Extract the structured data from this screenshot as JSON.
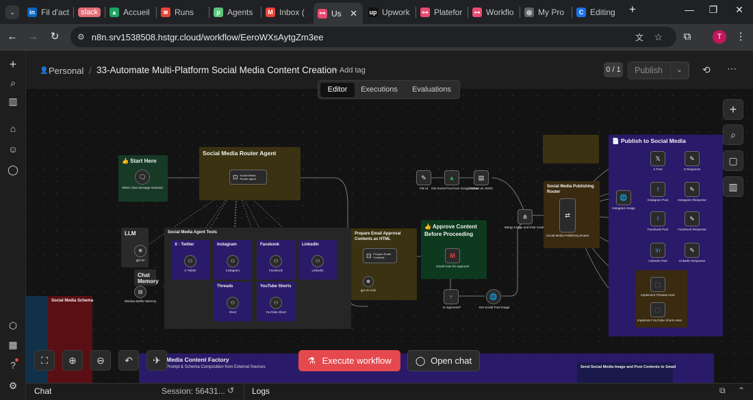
{
  "browser": {
    "tabs": [
      {
        "label": "Fil d'act",
        "icon": "linkedin-icon",
        "color": "#0a66c2",
        "glyph": "in"
      },
      {
        "label": "slack",
        "icon": "slack-badge-icon",
        "color": "#e06c75",
        "glyph": ""
      },
      {
        "label": "Accueil",
        "icon": "google-drive-icon",
        "color": "#1fa463",
        "glyph": "▲"
      },
      {
        "label": "Runs",
        "icon": "runs-icon",
        "color": "#e8453c",
        "glyph": "≋"
      },
      {
        "label": "Agents",
        "icon": "agents-icon",
        "color": "#5bc57a",
        "glyph": "p"
      },
      {
        "label": "Inbox (",
        "icon": "gmail-icon",
        "color": "#ea4335",
        "glyph": "M"
      },
      {
        "label": "Us",
        "icon": "n8n-icon",
        "color": "#ea4b71",
        "glyph": "⊶"
      },
      {
        "label": "Upwork",
        "icon": "upwork-icon",
        "color": "#111111",
        "glyph": "up"
      },
      {
        "label": "Platefor",
        "icon": "n8n-icon",
        "color": "#ea4b71",
        "glyph": "⊶"
      },
      {
        "label": "Workflo",
        "icon": "n8n-icon",
        "color": "#ea4b71",
        "glyph": "⊶"
      },
      {
        "label": "My Pro",
        "icon": "globe-icon",
        "color": "#5f6368",
        "glyph": "◎"
      },
      {
        "label": "Editing",
        "icon": "editing-icon",
        "color": "#1a73e8",
        "glyph": "C"
      }
    ],
    "url": "n8n.srv1538508.hstgr.cloud/workflow/EeroWXsAytgZm3ee",
    "profile_initial": "T"
  },
  "header": {
    "breadcrumb": "Personal",
    "title": "33-Automate Multi-Platform Social Media Content Creation",
    "add_tag": "+ Add tag",
    "counter": "0 / 1",
    "publish": "Publish"
  },
  "view_tabs": [
    "Editor",
    "Executions",
    "Evaluations"
  ],
  "stickies": {
    "start": "👍 Start Here",
    "router": "Social Media Router Agent",
    "llm": "LLM",
    "chat_memory": "Chat Memory",
    "tools": "Social Media Agent Tools",
    "schema": "Social Media Schema",
    "email": "Prepare Email Approval Contents as HTML",
    "approve": "👍 Approve Content Before Proceeding",
    "publishing": "Social Media Publishing Router",
    "publish_sm": "📄 Publish to Social Media",
    "factory": "Media Content Factory",
    "factory_sub": "Prompt & Schema Composition from External Sources",
    "gmail": "Send Social Media Image and Post Contents to Gmail"
  },
  "tool_tiles": [
    "X - Twitter",
    "Instagram",
    "Facebook",
    "LinkedIn",
    "Threads",
    "YouTube Shorts"
  ],
  "node_labels": {
    "chat_trigger": "When chat message received",
    "router_agent": "Social Media Router Agent",
    "llm_model": "gpt-4o",
    "memory": "Window Buffer Memory",
    "x_tool": "X Twitter",
    "insta_tool": "Instagram",
    "fb_tool": "Facebook",
    "li_tool": "LinkedIn",
    "threads_tool": "Short",
    "yt_tool": "YouTube Short",
    "email_contents": "Prepare Email Contents",
    "email_model": "gpt-4o-mini",
    "gmail_approval": "Gmail User for Approval",
    "is_approved": "Is Approved?",
    "get_social_image": "Get Social Post Image",
    "file_id": "File Id",
    "get_drive": "Get Social Post from Google Drive",
    "extract_json": "Extract as JSON",
    "merge": "Merge Image and Post Contents",
    "pub_router": "Social Media Publishing Router",
    "ig_image": "Instagram Image",
    "x_post": "X Post",
    "x_resp": "X Response",
    "ig_post": "Instagram Post",
    "ig_resp": "Instagram Response",
    "fb_post": "Facebook Post",
    "fb_resp": "Facebook Response",
    "li_post": "LinkedIn Post",
    "li_resp": "LinkedIn Response",
    "impl_threads": "Implement Threads Here",
    "impl_yt": "Implement YouTube Shorts Here"
  },
  "buttons": {
    "execute": "Execute workflow",
    "open_chat": "Open chat"
  },
  "bottom": {
    "chat": "Chat",
    "session": "Session: 56431...",
    "logs": "Logs"
  }
}
